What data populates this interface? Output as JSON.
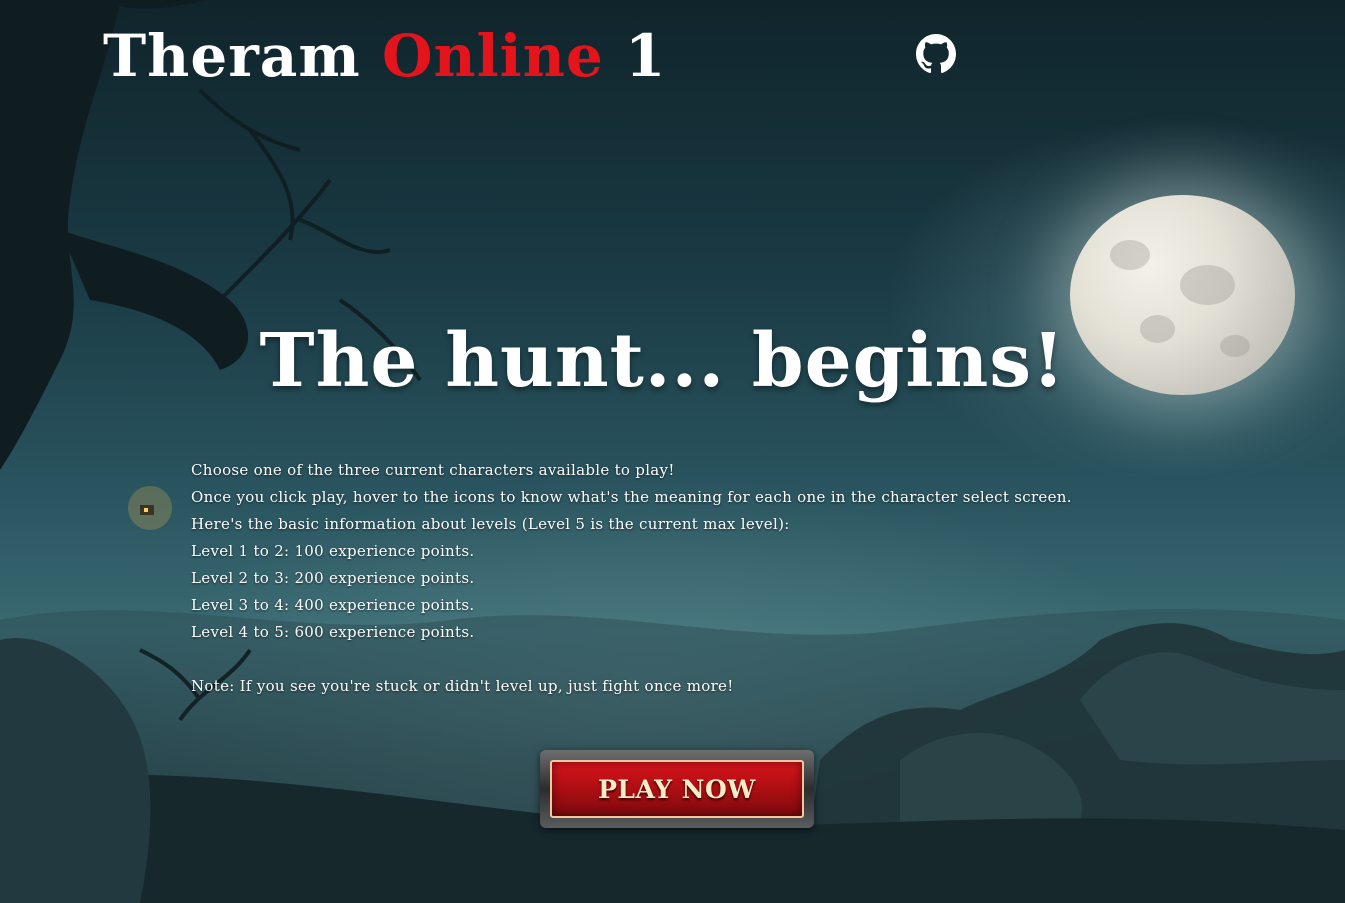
{
  "header": {
    "title_main": "Theram",
    "title_accent": "Online",
    "title_suffix": "1",
    "github_icon": "github-icon"
  },
  "hero": {
    "headline": "The hunt... begins!"
  },
  "info": {
    "lines": [
      "Choose one of the three current characters available to play!",
      "Once you click play, hover to the icons to know what's the meaning for each one in the character select screen.",
      "Here's the basic information about levels (Level 5 is the current max level):",
      "Level 1 to 2: 100 experience points.",
      "Level 2 to 3: 200 experience points.",
      "Level 3 to 4: 400 experience points.",
      "Level 4 to 5: 600 experience points."
    ],
    "note": "Note: If you see you're stuck or didn't level up, just fight once more!"
  },
  "play_button": {
    "label": "PLAY NOW"
  },
  "colors": {
    "accent": "#e3141c",
    "text": "#ffffff",
    "button_red": "#b10f14"
  }
}
